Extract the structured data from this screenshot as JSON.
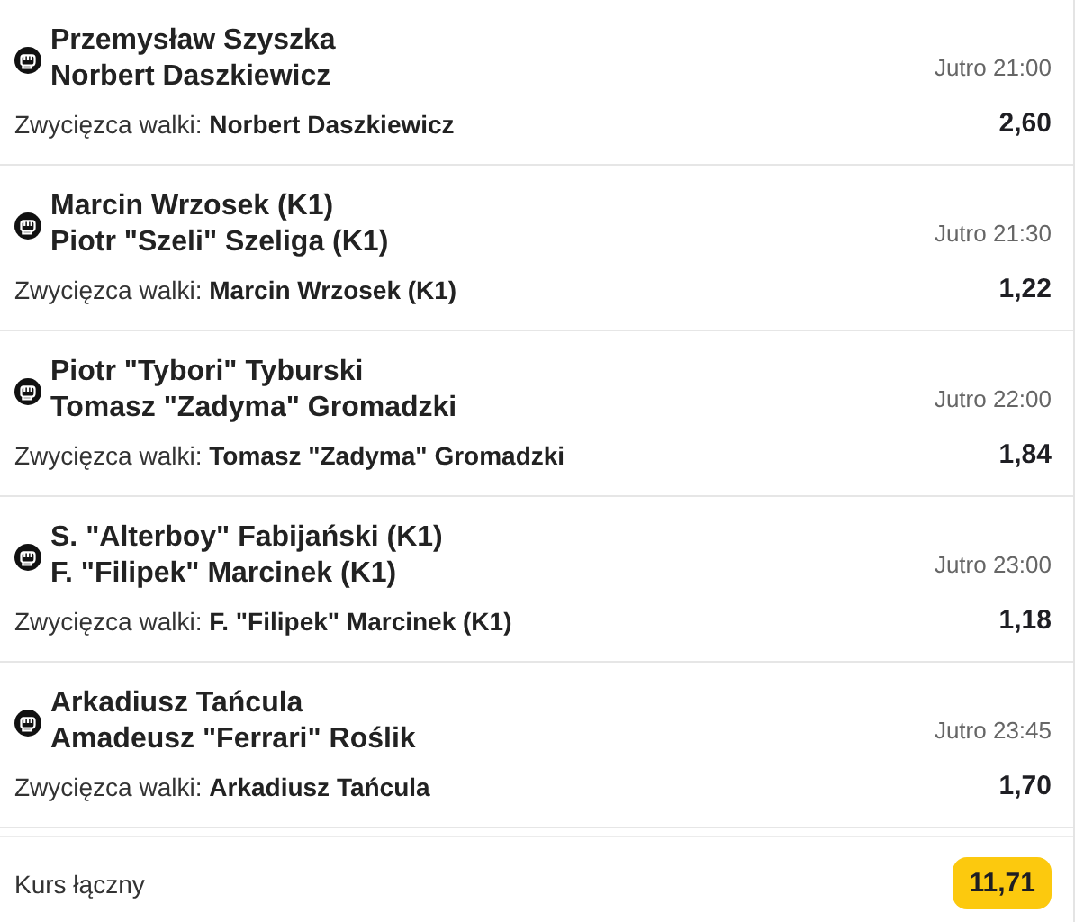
{
  "events": [
    {
      "fighters": [
        "Przemysław Szyszka",
        "Norbert Daszkiewicz"
      ],
      "time": "Jutro 21:00",
      "market": "Zwycięzca walki:",
      "pick": "Norbert Daszkiewicz",
      "odds": "2,60"
    },
    {
      "fighters": [
        "Marcin Wrzosek (K1)",
        "Piotr \"Szeli\" Szeliga (K1)"
      ],
      "time": "Jutro 21:30",
      "market": "Zwycięzca walki:",
      "pick": "Marcin Wrzosek (K1)",
      "odds": "1,22"
    },
    {
      "fighters": [
        "Piotr \"Tybori\" Tyburski",
        "Tomasz \"Zadyma\" Gromadzki"
      ],
      "time": "Jutro 22:00",
      "market": "Zwycięzca walki:",
      "pick": "Tomasz \"Zadyma\" Gromadzki",
      "odds": "1,84"
    },
    {
      "fighters": [
        "S. \"Alterboy\" Fabijański (K1)",
        "F. \"Filipek\" Marcinek (K1)"
      ],
      "time": "Jutro 23:00",
      "market": "Zwycięzca walki:",
      "pick": "F. \"Filipek\" Marcinek (K1)",
      "odds": "1,18"
    },
    {
      "fighters": [
        "Arkadiusz Tańcula",
        "Amadeusz \"Ferrari\" Roślik"
      ],
      "time": "Jutro 23:45",
      "market": "Zwycięzca walki:",
      "pick": "Arkadiusz Tańcula",
      "odds": "1,70"
    }
  ],
  "total": {
    "label": "Kurs łączny",
    "value": "11,71"
  }
}
